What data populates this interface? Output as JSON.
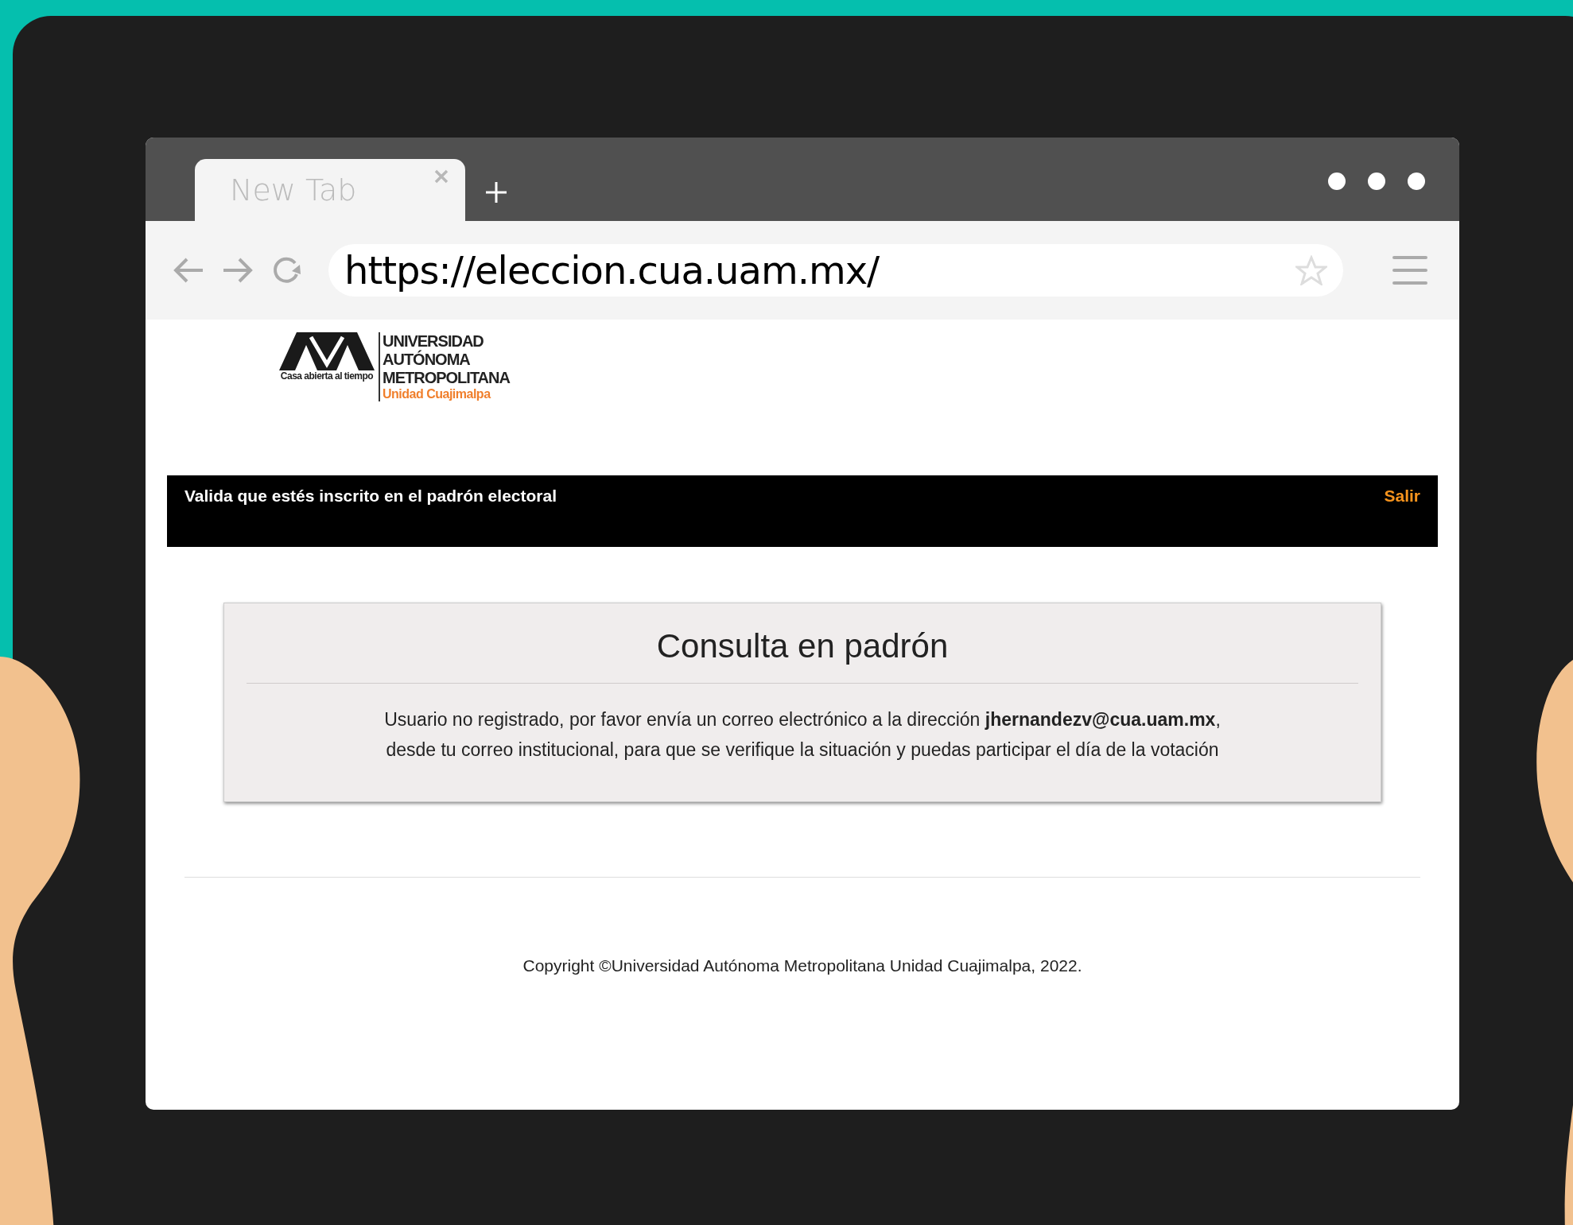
{
  "browser": {
    "tab": {
      "title": "New Tab",
      "selected": true
    },
    "address": "https://eleccion.cua.uam.mx/"
  },
  "logo": {
    "tagline": "Casa abierta al tiempo",
    "name_lines": [
      "UNIVERSIDAD",
      "AUTÓNOMA",
      "METROPOLITANA"
    ],
    "unit": "Unidad Cuajimalpa"
  },
  "header_bar": {
    "title": "Valida que estés inscrito en el padrón electoral",
    "link": "Salir"
  },
  "card": {
    "title": "Consulta en padrón",
    "message": "Usuario no registrado, por favor envía un correo electrónico a la dirección **jhernandezv@cua.uam.mx**,\ndesde tu correo institucional, para que se verifique la situación y puedas participar el día de la votación"
  },
  "footer": {
    "copyright": "Copyright ©Universidad Autónoma Metropolitana Unidad Cuajimalpa, 2022."
  }
}
